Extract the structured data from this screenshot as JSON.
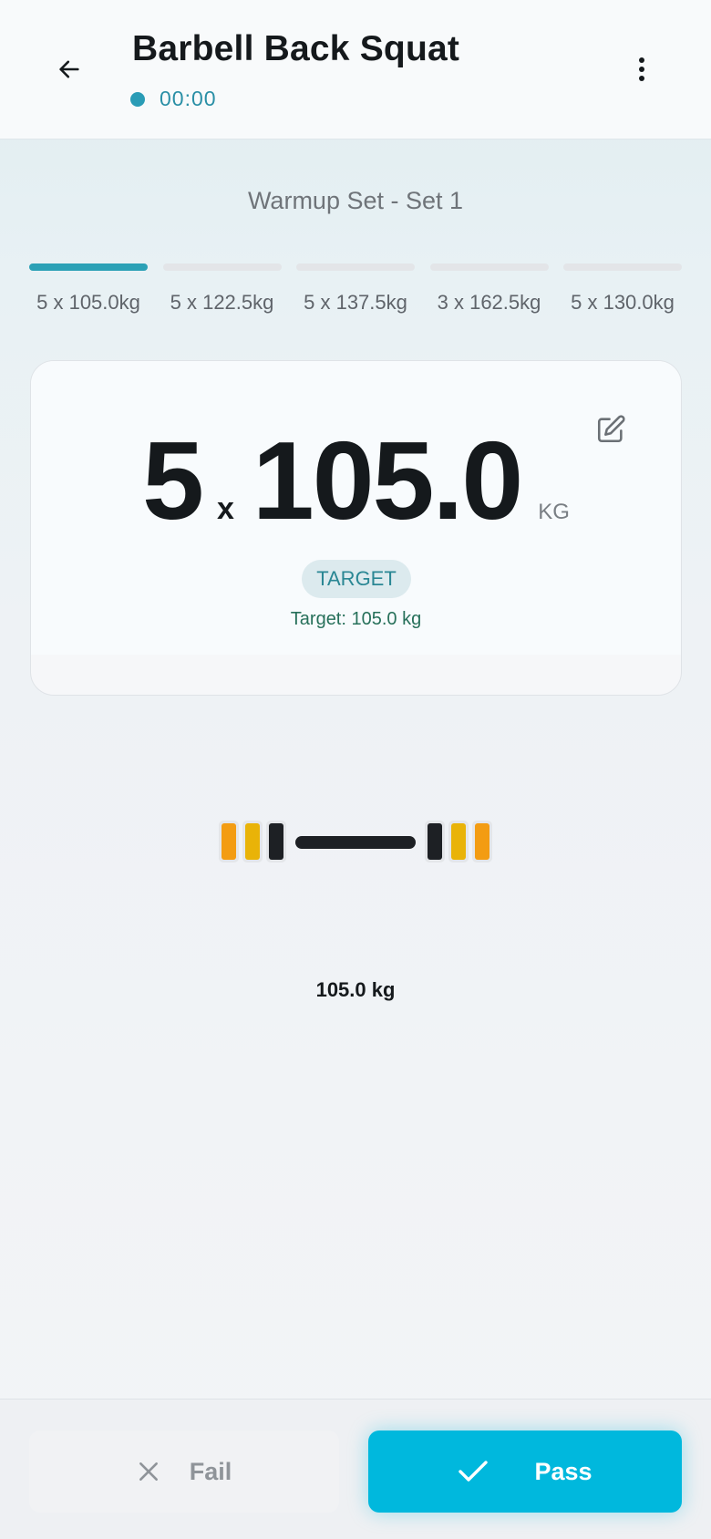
{
  "header": {
    "title": "Barbell Back Squat",
    "timer": "00:00",
    "back_icon": "arrow-left-icon",
    "menu_icon": "more-vertical-icon"
  },
  "set_label": "Warmup Set - Set 1",
  "sets": [
    {
      "label": "5 x 105.0kg",
      "active": true
    },
    {
      "label": "5 x 122.5kg",
      "active": false
    },
    {
      "label": "5 x 137.5kg",
      "active": false
    },
    {
      "label": "3 x 162.5kg",
      "active": false
    },
    {
      "label": "5 x 130.0kg",
      "active": false
    }
  ],
  "card": {
    "reps": "5",
    "times": "x",
    "weight": "105.0",
    "unit": "KG",
    "badge": "TARGET",
    "target_note": "Target: 105.0 kg",
    "edit_icon": "edit-icon"
  },
  "barbell": {
    "total": "105.0 kg",
    "plate_colors": [
      "#f39c12",
      "#e9b308",
      "#1d2024"
    ]
  },
  "actions": {
    "fail": "Fail",
    "pass": "Pass"
  },
  "colors": {
    "accent": "#2ba1b6",
    "pass": "#00b8dd"
  }
}
